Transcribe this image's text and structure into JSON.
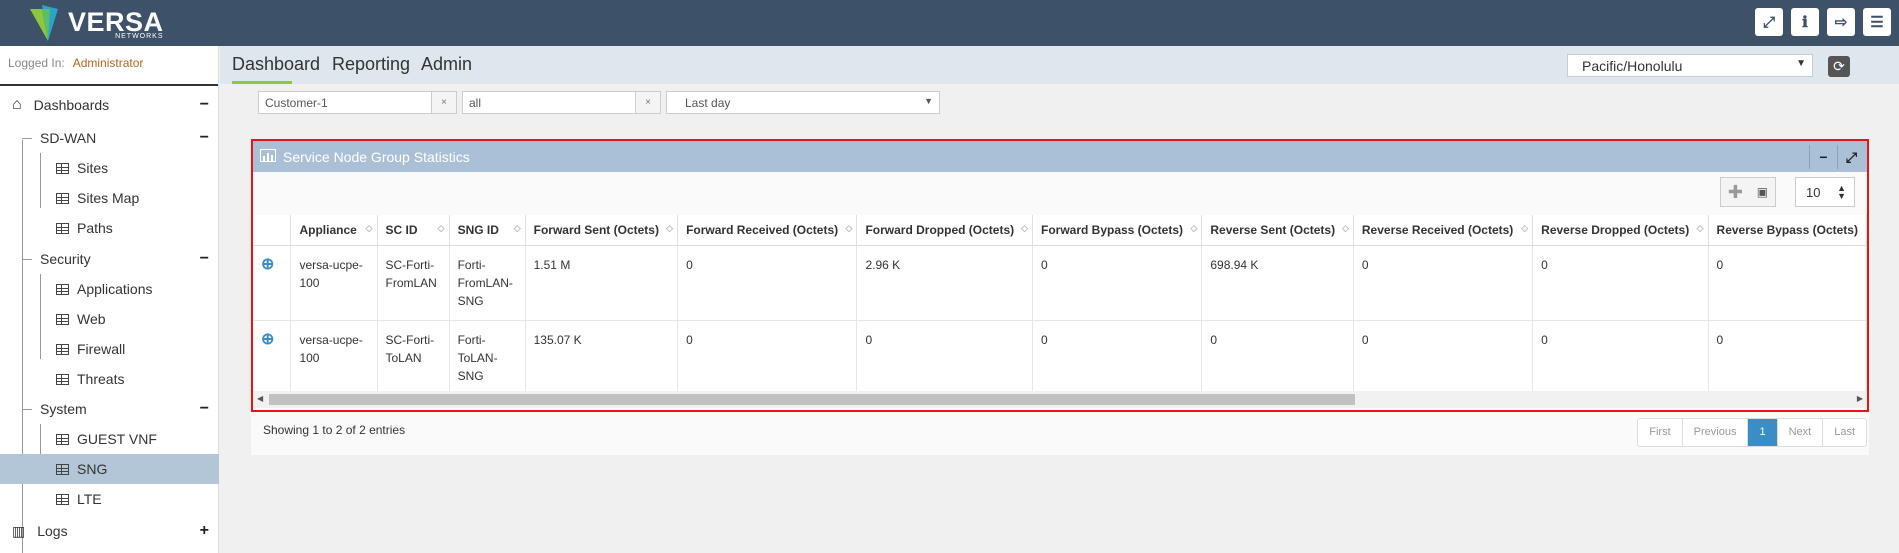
{
  "logo": {
    "name": "VERSA",
    "sub": "NETWORKS"
  },
  "header_icons": [
    "expand-icon",
    "info-icon",
    "logout-icon",
    "menu-icon"
  ],
  "login": {
    "label": "Logged In:",
    "user": "Administrator"
  },
  "sidebar": {
    "dashboards": "Dashboards",
    "sdwan": "SD-WAN",
    "sites": "Sites",
    "sites_map": "Sites Map",
    "paths": "Paths",
    "security": "Security",
    "applications": "Applications",
    "web": "Web",
    "firewall": "Firewall",
    "threats": "Threats",
    "system": "System",
    "guest_vnf": "GUEST VNF",
    "sng": "SNG",
    "lte": "LTE",
    "logs": "Logs"
  },
  "menu": {
    "dashboard": "Dashboard",
    "reporting": "Reporting",
    "admin": "Admin"
  },
  "timezone": "Pacific/Honolulu",
  "filters": {
    "tenant": "Customer-1",
    "appliance": "all",
    "range": "Last day"
  },
  "panel": {
    "title": "Service Node Group Statistics",
    "page_size": "10",
    "columns": [
      "Appliance",
      "SC ID",
      "SNG ID",
      "Forward Sent (Octets)",
      "Forward Received (Octets)",
      "Forward Dropped (Octets)",
      "Forward Bypass (Octets)",
      "Reverse Sent (Octets)",
      "Reverse Received (Octets)",
      "Reverse Dropped (Octets)",
      "Reverse Bypass (Octets)"
    ],
    "rows": [
      [
        "versa-ucpe-100",
        "SC-Forti-FromLAN",
        "Forti-FromLAN-SNG",
        "1.51 M",
        "0",
        "2.96 K",
        "0",
        "698.94 K",
        "0",
        "0",
        "0"
      ],
      [
        "versa-ucpe-100",
        "SC-Forti-ToLAN",
        "Forti-ToLAN-SNG",
        "135.07 K",
        "0",
        "0",
        "0",
        "0",
        "0",
        "0",
        "0"
      ]
    ],
    "info": "Showing 1 to 2 of 2 entries",
    "pager": {
      "first": "First",
      "previous": "Previous",
      "current": "1",
      "next": "Next",
      "last": "Last"
    }
  },
  "colors": {
    "topbar": "#3d5168",
    "accent": "#8dc63f",
    "panel_head": "#a9c0d6",
    "highlight_border": "#e5141b",
    "link": "#3a8dc7"
  }
}
